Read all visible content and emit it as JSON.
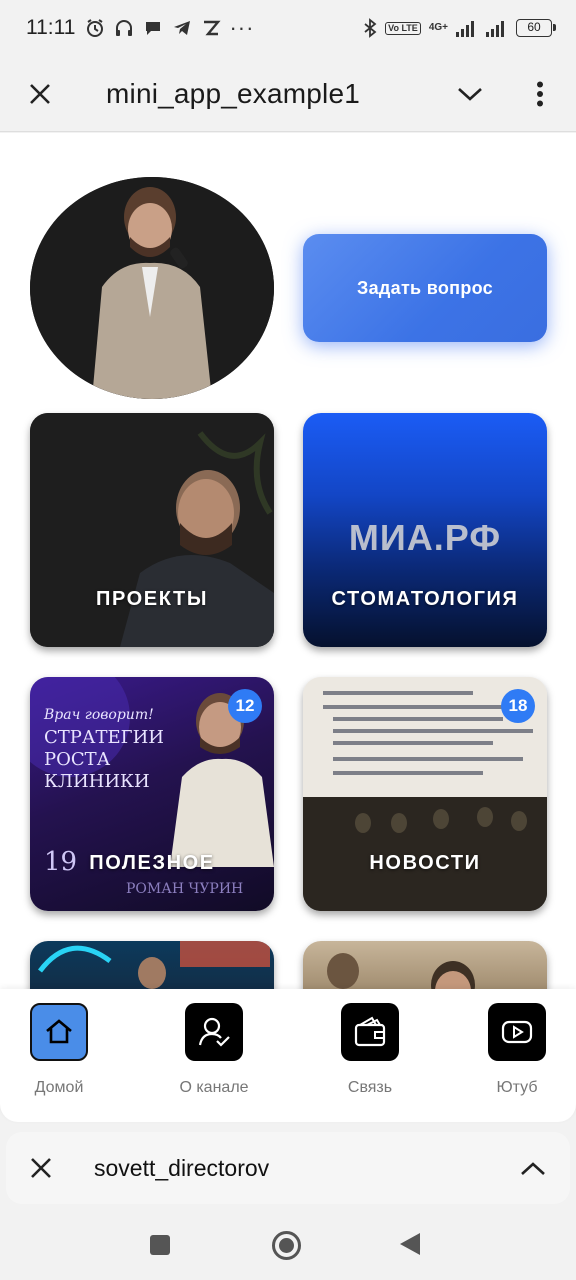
{
  "status_bar": {
    "time": "11:11",
    "volte": "Vo LTE",
    "network": "4G+",
    "battery": "60"
  },
  "app_bar": {
    "title": "mini_app_example1"
  },
  "main": {
    "ask_button": "Задать вопрос",
    "tiles": [
      {
        "label": "ПРОЕКТЫ"
      },
      {
        "label": "СТОМАТОЛОГИЯ",
        "logo_text": "МИА.РФ"
      },
      {
        "label": "ПОЛЕЗНОЕ",
        "badge": "12",
        "poster_lines": [
          "Врач говорит!",
          "СТРАТЕГИИ",
          "РОСТА",
          "КЛИНИКИ"
        ],
        "poster_date": "19",
        "poster_name": "РОМАН ЧУРИН"
      },
      {
        "label": "НОВОСТИ",
        "badge": "18"
      }
    ]
  },
  "tabbar": {
    "tabs": [
      {
        "label": "Домой",
        "icon": "home-icon",
        "active": true
      },
      {
        "label": "О канале",
        "icon": "user-check-icon"
      },
      {
        "label": "Связь",
        "icon": "wallet-icon"
      },
      {
        "label": "Ютуб",
        "icon": "youtube-icon"
      }
    ]
  },
  "sheet": {
    "title": "sovett_directorov"
  },
  "colors": {
    "accent": "#4a8de8",
    "ask_button": "#3c73e6",
    "badge": "#2f7bf5",
    "dental_tile": "#1b5cf5"
  }
}
